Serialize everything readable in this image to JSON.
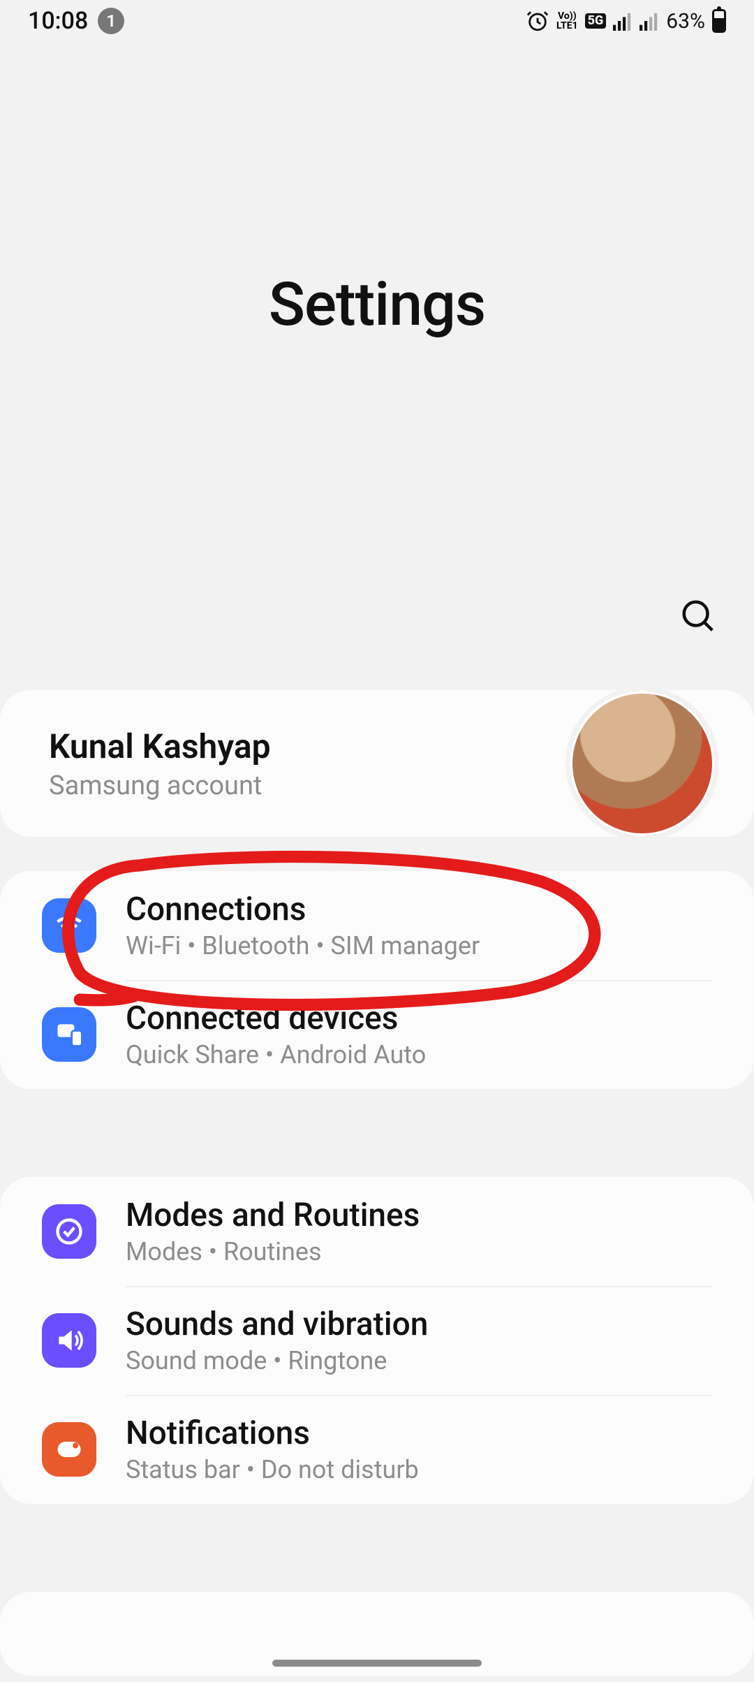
{
  "status": {
    "time": "10:08",
    "notification_count": "1",
    "lte_label_top": "Vo))",
    "lte_label_bottom": "LTE1",
    "net_badge": "5G",
    "battery_pct": "63%"
  },
  "hero": {
    "title": "Settings"
  },
  "account": {
    "name": "Kunal Kashyap",
    "subtitle": "Samsung account"
  },
  "groups": [
    {
      "rows": [
        {
          "icon": "wifi-icon",
          "icon_bg": "ri-blue",
          "title": "Connections",
          "sub": "Wi-Fi  •  Bluetooth  •  SIM manager"
        },
        {
          "icon": "devices-icon",
          "icon_bg": "ri-blue",
          "title": "Connected devices",
          "sub": "Quick Share  •  Android Auto"
        }
      ]
    },
    {
      "rows": [
        {
          "icon": "routines-icon",
          "icon_bg": "ri-purple",
          "title": "Modes and Routines",
          "sub": "Modes  •  Routines"
        },
        {
          "icon": "sound-icon",
          "icon_bg": "ri-purple",
          "title": "Sounds and vibration",
          "sub": "Sound mode  •  Ringtone"
        },
        {
          "icon": "notification-icon",
          "icon_bg": "ri-orange",
          "title": "Notifications",
          "sub": "Status bar  •  Do not disturb"
        }
      ]
    }
  ],
  "annotation": {
    "shows_circle": true,
    "around_row": "Connections"
  }
}
